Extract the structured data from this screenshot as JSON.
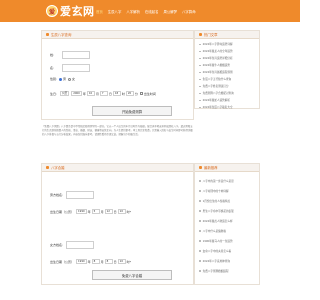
{
  "header": {
    "logo_badge": "爱",
    "logo_text": "爱玄网",
    "nav": [
      "首页",
      "生辰八字",
      "八字解析",
      "在线起名",
      "周公解梦",
      "八字算命"
    ]
  },
  "birth_form": {
    "title": "生辰八字查询",
    "surname_label": "姓:",
    "name_label": "名:",
    "gender_label": "性别:",
    "gender_options": [
      "男",
      "女"
    ],
    "birth_label": "生日:",
    "calendar": "公历",
    "year": "2000",
    "month": "10",
    "day": "7",
    "hour": "18",
    "minute": "20",
    "unit_year": "年",
    "unit_month": "月",
    "unit_day": "日",
    "unit_hour": "时",
    "unit_minute": "分",
    "cb_text": "出生时间",
    "submit": "开始免费测算"
  },
  "intro": {
    "text": "「免费八字测算」八字算命是中华传统民俗预测学的一部分，它以一个人出生的年月日时作为依据，配合天干地支排列成四柱八字，透过阴阳五行的生克制化推算人的性格、事业、婚姻、财运、健康等运势走向，为人生提供参考。本工具完全免费，只需输入姓名与出生时间即可获得详细的八字排盘与五行分析结果，内容仅供娱乐参考，请理性看待命理之说，把握当下积极生活。"
  },
  "match_form": {
    "title": "八字合婚",
    "male_label": "男方姓名:",
    "male_birth_label": "出生日期（公历）",
    "male_year": "1990",
    "male_month": "5",
    "male_day": "12",
    "male_hour": "10",
    "female_label": "女方姓名:",
    "female_birth_label": "出生日期（公历）",
    "female_year": "1990",
    "female_month": "8",
    "female_day": "8",
    "female_hour": "10",
    "time_suffix": "时*",
    "unit_year": "年",
    "unit_month": "月",
    "unit_day": "日",
    "submit": "免费八字合婚"
  },
  "hot_articles": {
    "title": "热门文章",
    "items": [
      "2024年八字算命运势详解",
      "2024年属龙人的全年运势",
      "2024年生肖运势详细分析",
      "2024年属牛人婚姻运势",
      "2024年生肖属相运程预测",
      "生辰八字五行缺什么查询",
      "免费八字姓名测试打分",
      "免费测算八字合婚配对查询",
      "2024年属蛇人运势解析",
      "2024年生辰八字取名大全"
    ]
  },
  "latest_articles": {
    "title": "最新推荐",
    "items": [
      "八字中的第一步是什么意思",
      "八字命理中的十神详解",
      "1月份出生的人性格特点",
      "男生八字命中带桃花的表现",
      "2024年属虎人财运怎么样",
      "八字中什么是偏财格",
      "1990年属马人的一生运势",
      "女命八字中的夫星怎么看",
      "2024年八字喜用神查询",
      "免费八字测算婚姻运程"
    ]
  },
  "colors": {
    "accent": "#ef8a2b",
    "title_text": "#d9681a"
  }
}
